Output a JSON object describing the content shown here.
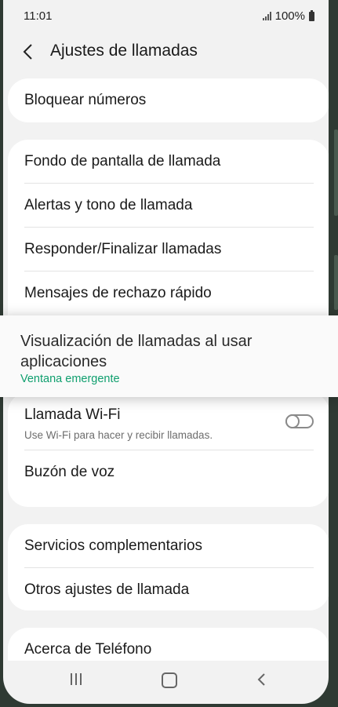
{
  "status_bar": {
    "time": "11:01",
    "battery": "100%"
  },
  "header": {
    "title": "Ajustes de llamadas"
  },
  "group_block": {
    "items": [
      {
        "label": "Bloquear números"
      }
    ]
  },
  "group_call": {
    "items": [
      {
        "label": "Fondo de pantalla de llamada"
      },
      {
        "label": "Alertas y tono de llamada"
      },
      {
        "label": "Responder/Finalizar llamadas"
      },
      {
        "label": "Mensajes de rechazo rápido"
      }
    ]
  },
  "popup": {
    "title": "Visualización de llamadas al usar aplicaciones",
    "value": "Ventana emergente"
  },
  "group_wifi": {
    "wifi_call": {
      "label": "Llamada Wi-Fi",
      "description": "Use Wi-Fi para hacer y recibir llamadas.",
      "enabled": false
    },
    "voicemail": {
      "label": "Buzón de voz"
    }
  },
  "group_services": {
    "items": [
      {
        "label": "Servicios complementarios"
      },
      {
        "label": "Otros ajustes de llamada"
      }
    ]
  },
  "group_about": {
    "items": [
      {
        "label": "Acerca de Teléfono"
      }
    ]
  },
  "navbar": {
    "icons": [
      "recent-apps-icon",
      "home-icon",
      "back-icon"
    ]
  },
  "colors": {
    "accent": "#0f9f6e",
    "background": "#f2f2f2",
    "card": "#ffffff"
  }
}
